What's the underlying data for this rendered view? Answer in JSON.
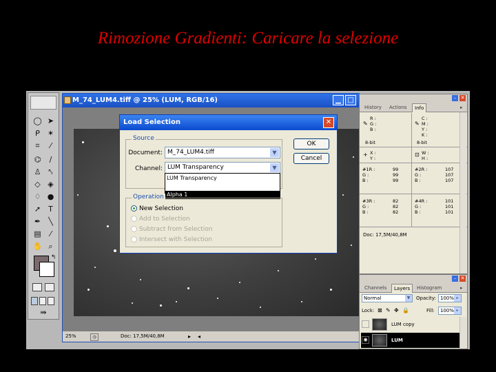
{
  "slide_title": "Rimozione Gradienti: Caricare la selezione",
  "document_window": {
    "title": "M_74_LUM4.tiff @ 25% (LUM, RGB/16)",
    "zoom": "25%",
    "status_doc": "Doc: 17,5M/40,8M"
  },
  "dialog": {
    "title": "Load Selection",
    "close_glyph": "✕",
    "source_label": "Source",
    "document_label": "Document:",
    "document_value": "M_74_LUM4.tiff",
    "channel_label": "Channel:",
    "channel_value": "LUM Transparency",
    "channel_options": [
      "LUM Transparency",
      "Alpha 1"
    ],
    "channel_highlighted": "Alpha 1",
    "operation_label": "Operation",
    "operations": [
      "New Selection",
      "Add to Selection",
      "Subtract from Selection",
      "Intersect with Selection"
    ],
    "ok_label": "OK",
    "cancel_label": "Cancel"
  },
  "info_palette": {
    "tabs": [
      "History",
      "Actions",
      "Info"
    ],
    "active_tab": "Info",
    "rgb_block": "R :\nG :\nB :",
    "cmyk_block": "C :\nM :\nY :\nK :",
    "bit_left": "8-bit",
    "bit_right": "8-bit",
    "xy_block": "X :\nY :",
    "wh_block": "W :\nH :",
    "samplers": [
      {
        "labels": "#1R :\nG :\nB :",
        "values": "99\n99\n99"
      },
      {
        "labels": "#2R :\nG :\nB :",
        "values": "107\n107\n107"
      },
      {
        "labels": "#3R :\nG :\nB :",
        "values": "82\n82\n82"
      },
      {
        "labels": "#4R :\nG :\nB :",
        "values": "101\n101\n101"
      }
    ],
    "doc_size": "Doc: 17,5M/40,8M"
  },
  "layers_palette": {
    "tabs": [
      "Channels",
      "Layers",
      "Histogram"
    ],
    "active_tab": "Layers",
    "blend_mode": "Normal",
    "opacity_label": "Opacity:",
    "opacity_value": "100%",
    "lock_label": "Lock:",
    "fill_label": "Fill:",
    "fill_value": "100%",
    "layers": [
      {
        "name": "LUM copy",
        "selected": false
      },
      {
        "name": "LUM",
        "selected": true
      }
    ]
  }
}
